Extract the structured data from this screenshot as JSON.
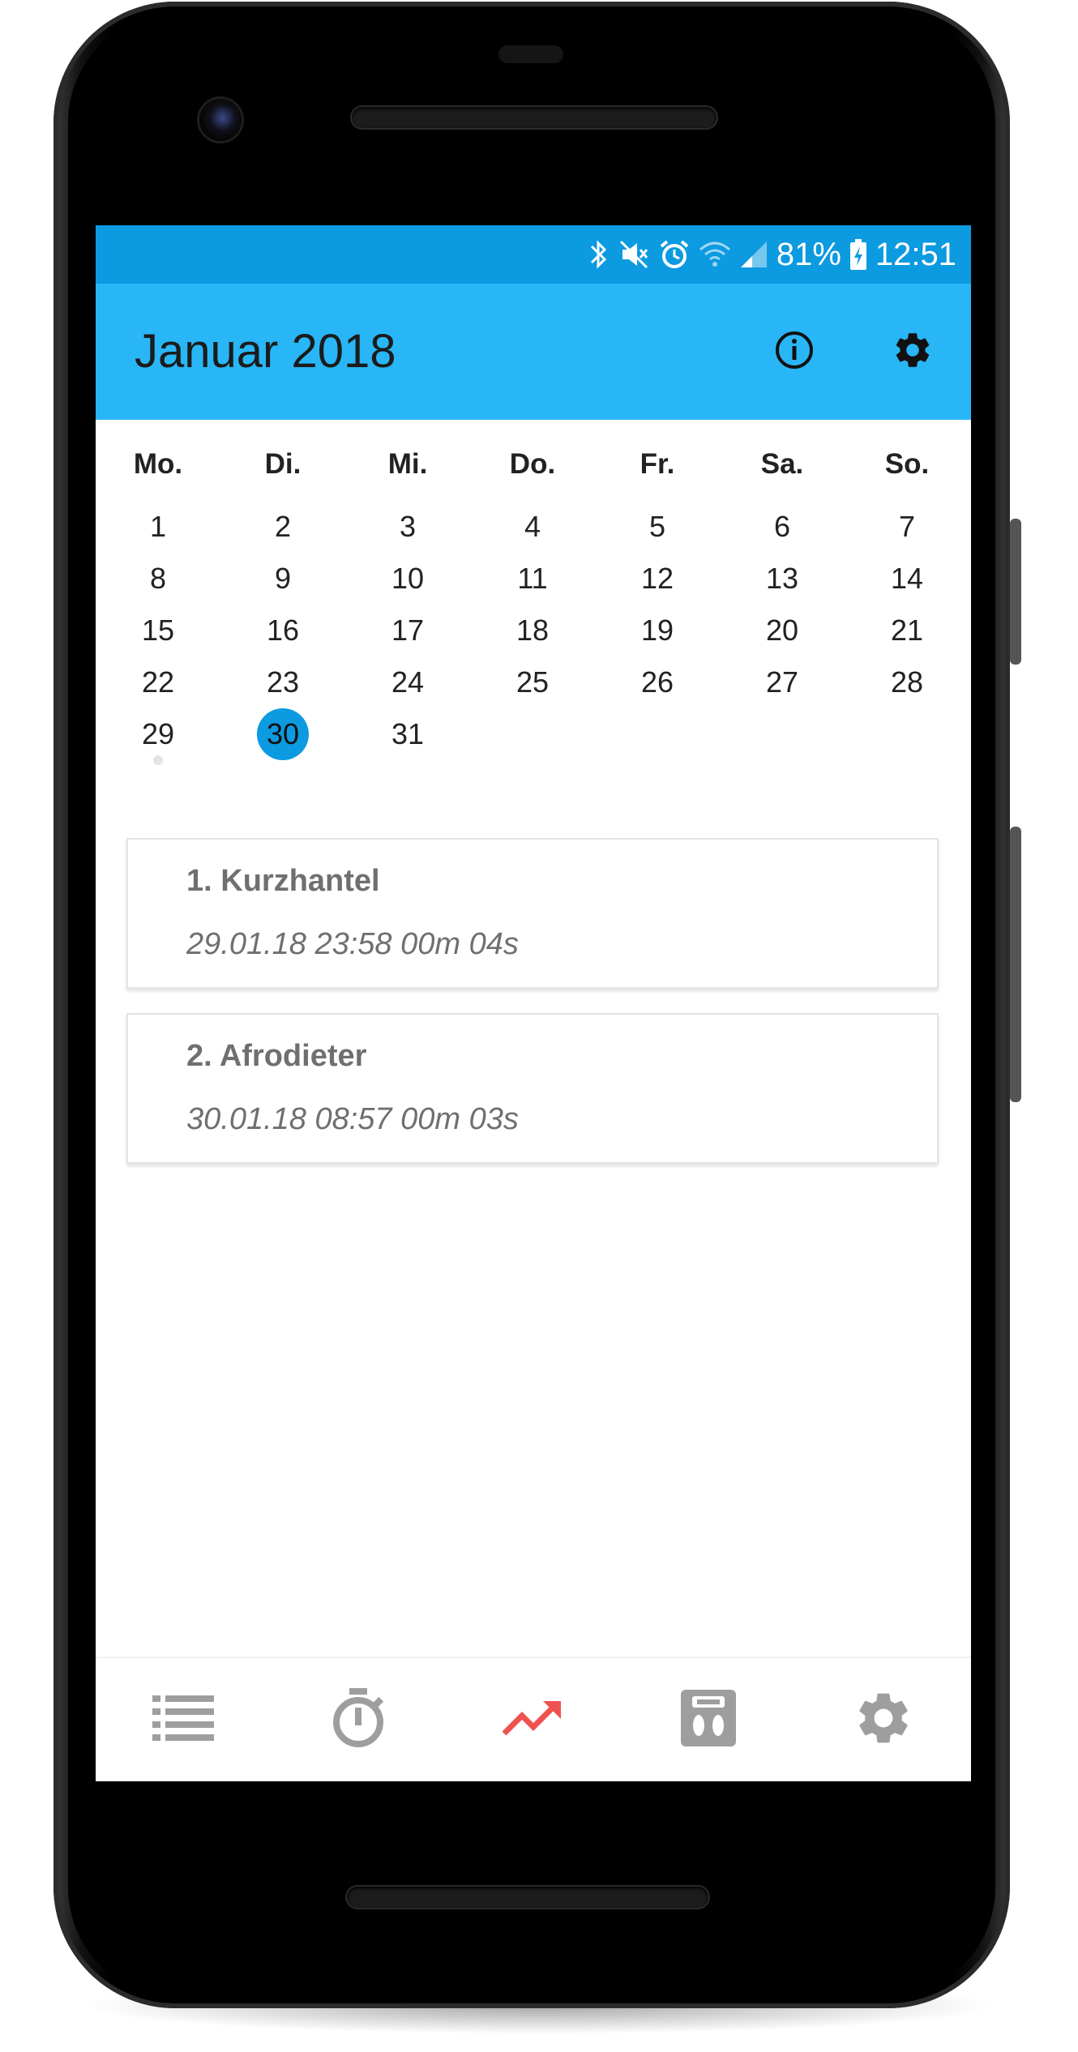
{
  "status_bar": {
    "battery": "81%",
    "time": "12:51",
    "icons": [
      "bluetooth-icon",
      "mute-icon",
      "alarm-icon",
      "wifi-icon",
      "signal-icon",
      "battery-charging-icon"
    ],
    "background": "#0c9ae0"
  },
  "app_bar": {
    "title": "Januar 2018",
    "background": "#29b6f6",
    "actions": [
      "info-icon",
      "settings-icon"
    ]
  },
  "calendar": {
    "weekdays": [
      "Mo.",
      "Di.",
      "Mi.",
      "Do.",
      "Fr.",
      "Sa.",
      "So."
    ],
    "weeks": [
      [
        "1",
        "2",
        "3",
        "4",
        "5",
        "6",
        "7"
      ],
      [
        "8",
        "9",
        "10",
        "11",
        "12",
        "13",
        "14"
      ],
      [
        "15",
        "16",
        "17",
        "18",
        "19",
        "20",
        "21"
      ],
      [
        "22",
        "23",
        "24",
        "25",
        "26",
        "27",
        "28"
      ],
      [
        "29",
        "30",
        "31",
        "",
        "",
        "",
        ""
      ]
    ],
    "selected_day": "30",
    "days_with_entries": [
      "29"
    ],
    "selected_color": "#0c9ae0"
  },
  "entries": [
    {
      "title": "1. Kurzhantel",
      "detail": "29.01.18 23:58 00m 04s"
    },
    {
      "title": "2. Afrodieter",
      "detail": "30.01.18 08:57 00m 03s"
    }
  ],
  "bottom_nav": {
    "items": [
      "list-icon",
      "stopwatch-icon",
      "trending-up-icon",
      "scale-icon",
      "settings-icon"
    ],
    "active_item": "trending-up-icon",
    "active_color": "#ef5350",
    "inactive_color": "#9e9e9e"
  }
}
